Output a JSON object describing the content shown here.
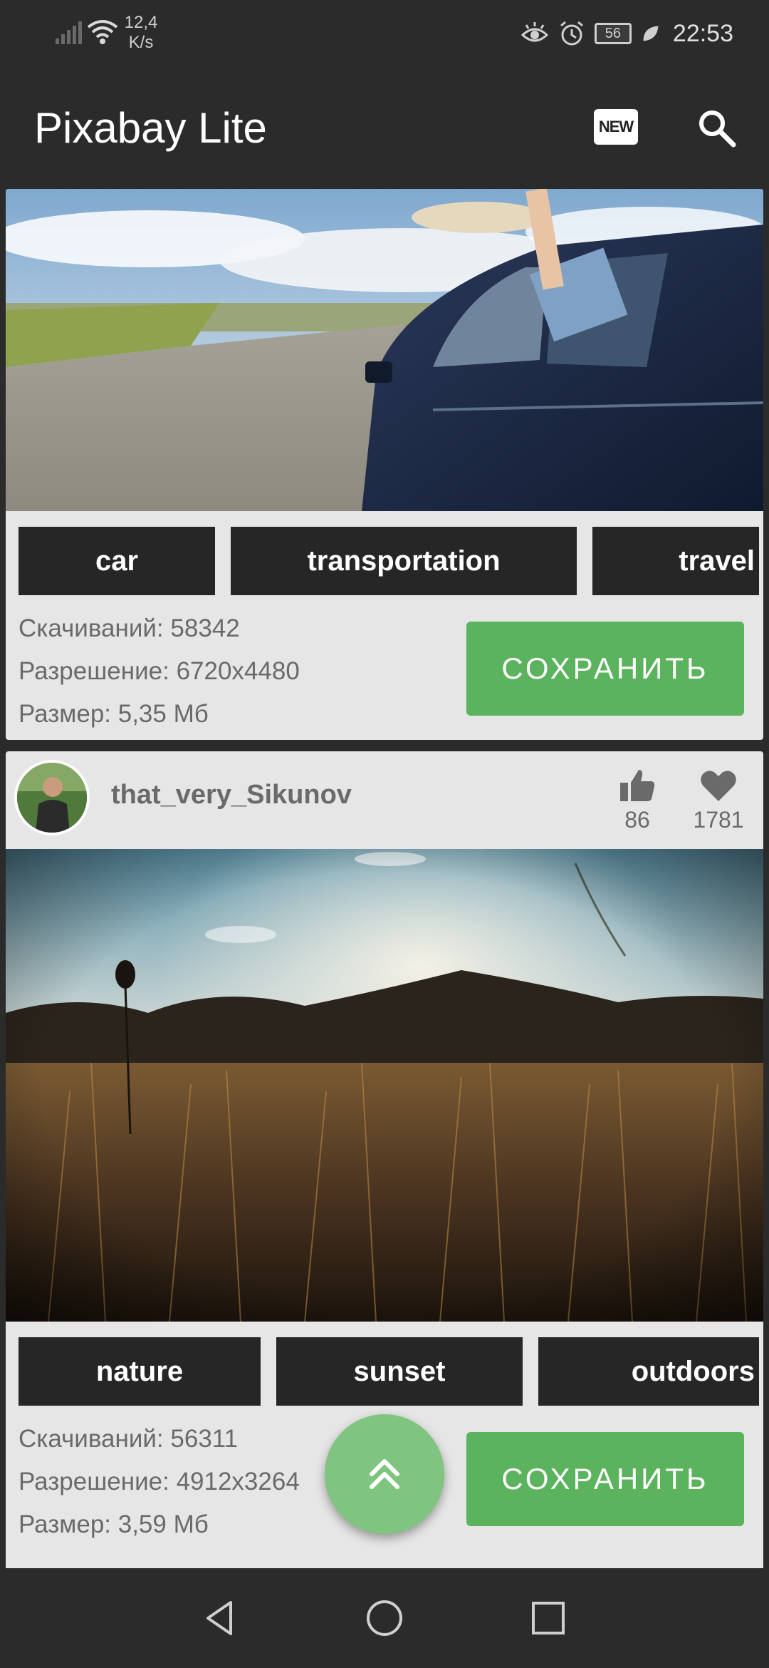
{
  "status_bar": {
    "net_speed_value": "12,4",
    "net_speed_unit": "K/s",
    "battery": "56",
    "time": "22:53"
  },
  "app_bar": {
    "title": "Pixabay Lite",
    "new_label": "NEW"
  },
  "cards": [
    {
      "tags": [
        "car",
        "transportation",
        "travel"
      ],
      "downloads": "Скачиваний: 58342",
      "resolution": "Разрешение: 6720x4480",
      "size": "Размер: 5,35 Мб",
      "save_label": "СОХРАНИТЬ"
    },
    {
      "username": "that_very_Sikunov",
      "likes": "86",
      "favorites": "1781",
      "tags": [
        "nature",
        "sunset",
        "outdoors"
      ],
      "downloads": "Скачиваний: 56311",
      "resolution": "Разрешение: 4912x3264",
      "size": "Размер: 3,59 Мб",
      "save_label": "СОХРАНИТЬ"
    }
  ],
  "icons": {
    "search": "search-icon",
    "like": "thumbs-up-icon",
    "favorite": "heart-icon",
    "scroll_top": "double-chevron-up-icon",
    "back": "nav-back-icon",
    "home": "nav-home-icon",
    "recents": "nav-recents-icon"
  },
  "colors": {
    "background": "#2b2b2b",
    "card": "#e6e6e6",
    "tag": "#262626",
    "save_button": "#5bb35d",
    "fab": "#7fc47f"
  }
}
